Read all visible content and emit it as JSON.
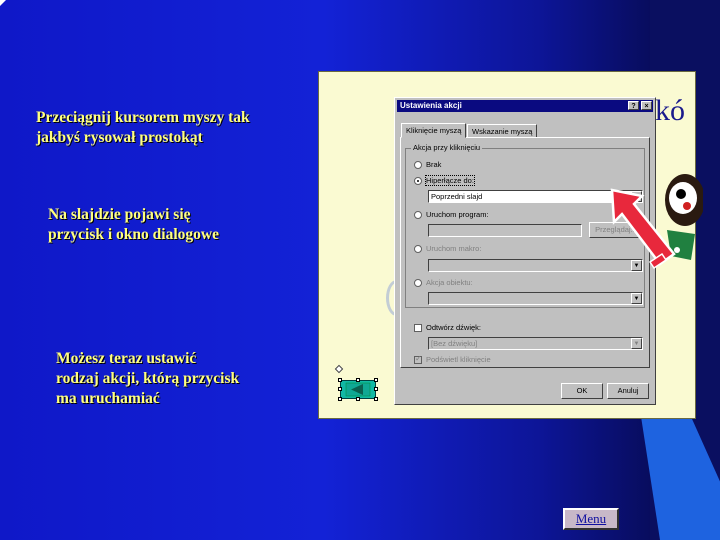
{
  "captions": {
    "drag_line1": "Przeciągnij kursorem myszy tak",
    "drag_line2": "jakbyś rysował prostokąt",
    "appears_line1": "Na slajdzie pojawi się",
    "appears_line2": "przycisk i okno dialogowe",
    "set_line1": "Możesz teraz ustawić",
    "set_line2": "rodzaj akcji, którą przycisk",
    "set_line3": "ma uruchamiać"
  },
  "slide": {
    "title_fragment": "kó"
  },
  "dialog": {
    "title": "Ustawienia akcji",
    "help_button": "?",
    "close_button": "×",
    "tabs": [
      "Kliknięcie myszą",
      "Wskazanie myszą"
    ],
    "group_label": "Akcja przy kliknięciu",
    "options": {
      "none": "Brak",
      "hyperlink": "Hiperłącze do:",
      "hyperlink_value": "Poprzedni slajd",
      "run_program": "Uruchom program:",
      "browse": "Przeglądaj...",
      "run_macro": "Uruchom makro:",
      "object_action": "Akcja obiektu:"
    },
    "play_sound": "Odtwórz dźwięk:",
    "sound_value": "[Bez dźwięku]",
    "highlight_click": "Podświetl kliknięcie",
    "ok": "OK",
    "cancel": "Anuluj"
  },
  "nav": {
    "menu_label": "Menu"
  },
  "colors": {
    "background": "#1322d6",
    "caption_text": "#ffff80",
    "arrow": "#e8283c",
    "action_button": "#11b8a4"
  }
}
